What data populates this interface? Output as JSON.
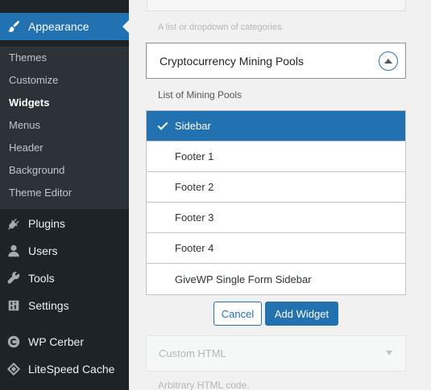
{
  "admin_menu": {
    "appearance": {
      "label": "Appearance",
      "icon": "paintbrush-icon"
    },
    "submenu": [
      "Themes",
      "Customize",
      "Widgets",
      "Menus",
      "Header",
      "Background",
      "Theme Editor"
    ],
    "current_submenu": "Widgets",
    "items": [
      {
        "label": "Plugins",
        "icon": "plugin-icon"
      },
      {
        "label": "Users",
        "icon": "user-icon"
      },
      {
        "label": "Tools",
        "icon": "wrench-icon"
      },
      {
        "label": "Settings",
        "icon": "settings-icon"
      },
      {
        "label": "WP Cerber",
        "icon": "cerber-icon"
      },
      {
        "label": "LiteSpeed Cache",
        "icon": "diamond-icon"
      }
    ]
  },
  "widgets": {
    "faded_above_desc": "A list or dropdown of categories.",
    "expanded_widget": {
      "title": "Cryptocurrency Mining Pools",
      "description": "List of Mining Pools"
    },
    "sidebar_options": [
      "Sidebar",
      "Footer 1",
      "Footer 2",
      "Footer 3",
      "Footer 4",
      "GiveWP Single Form Sidebar"
    ],
    "selected_sidebar": "Sidebar",
    "cancel_label": "Cancel",
    "add_label": "Add Widget",
    "faded_below": {
      "title": "Custom HTML",
      "description": "Arbitrary HTML code."
    }
  },
  "colors": {
    "sidebar_bg": "#1d2327",
    "submenu_bg": "#2c3338",
    "accent": "#2271b1",
    "content_bg": "#f1f1f1"
  }
}
